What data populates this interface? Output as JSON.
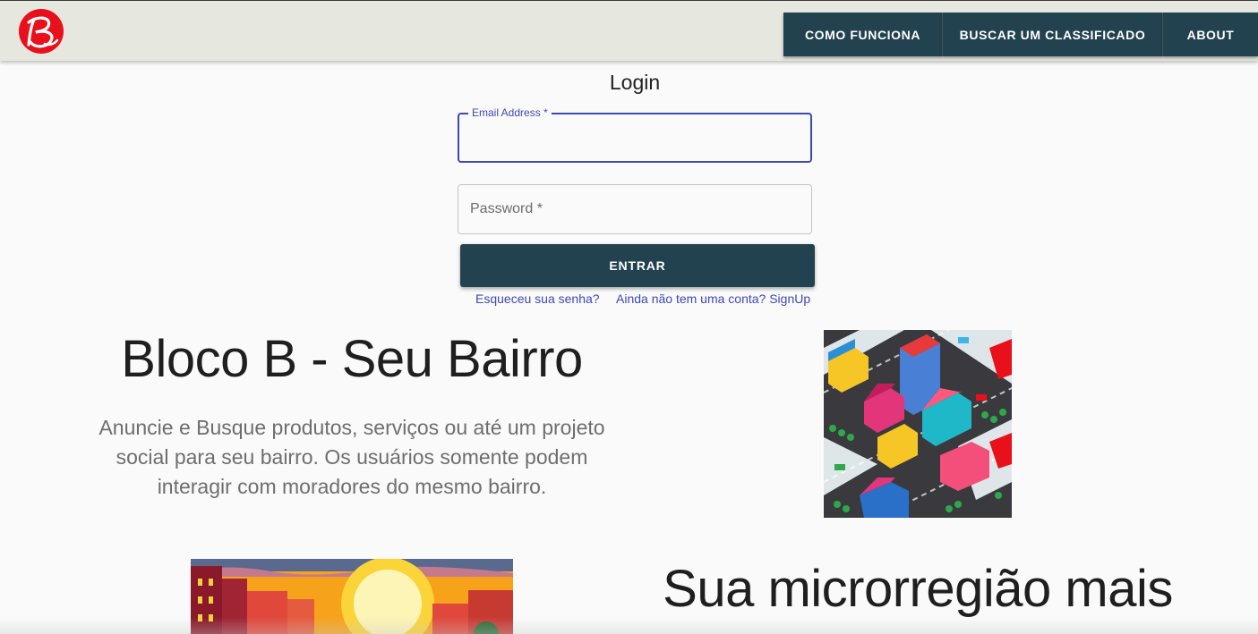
{
  "header": {
    "logo_letter": "B",
    "nav": [
      {
        "label": "COMO FUNCIONA"
      },
      {
        "label": "BUSCAR UM CLASSIFICADO"
      },
      {
        "label": "ABOUT"
      }
    ],
    "colors": {
      "bar": "#e6e7df",
      "nav_button": "#22424f",
      "logo": "#e8101a"
    }
  },
  "login": {
    "title": "Login",
    "email": {
      "label": "Email Address *",
      "value": ""
    },
    "password": {
      "label": "Password *",
      "value": ""
    },
    "submit_label": "ENTRAR",
    "forgot_link": "Esqueceu sua senha?",
    "signup_link": "Ainda não tem uma conta? SignUp",
    "accent": "#3f47b5"
  },
  "hero": {
    "title": "Bloco B - Seu Bairro",
    "description": "Anuncie e Busque produtos, serviços ou até um projeto social para seu bairro. Os usuários somente podem interagir com moradores do mesmo bairro."
  },
  "section2": {
    "title": "Sua microrregião mais"
  }
}
